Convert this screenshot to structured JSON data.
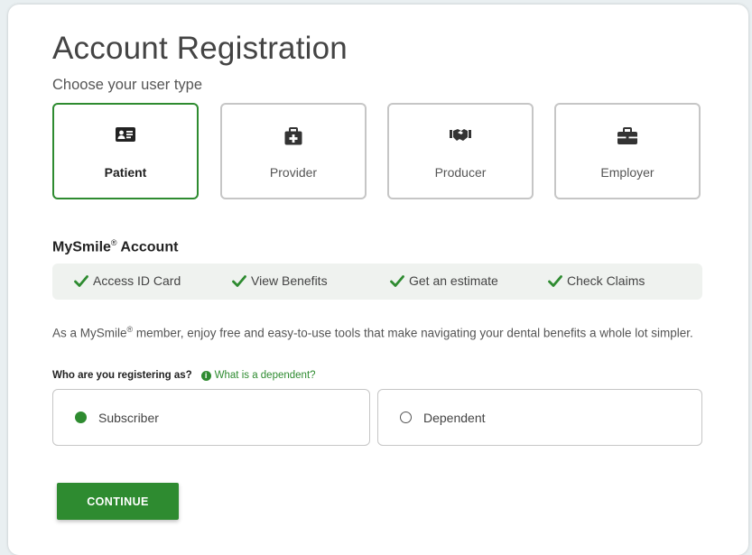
{
  "page": {
    "title": "Account Registration",
    "subtitle": "Choose your user type"
  },
  "user_types": [
    {
      "label": "Patient",
      "icon": "id-card-icon",
      "selected": true
    },
    {
      "label": "Provider",
      "icon": "medical-kit-icon",
      "selected": false
    },
    {
      "label": "Producer",
      "icon": "handshake-icon",
      "selected": false
    },
    {
      "label": "Employer",
      "icon": "briefcase-icon",
      "selected": false
    }
  ],
  "account": {
    "title": "MySmile",
    "title_mark": "®",
    "title_suffix": " Account",
    "features": [
      "Access ID Card",
      "View Benefits",
      "Get an estimate",
      "Check Claims"
    ],
    "desc_prefix": "As a MySmile",
    "desc_mark": "®",
    "desc_suffix": " member, enjoy free and easy-to-use tools that make navigating your dental benefits a whole lot simpler."
  },
  "registration": {
    "question": "Who are you registering as?",
    "dependent_link": "What is a dependent?",
    "options": [
      {
        "label": "Subscriber",
        "selected": true
      },
      {
        "label": "Dependent",
        "selected": false
      }
    ]
  },
  "actions": {
    "continue_label": "CONTINUE"
  },
  "colors": {
    "accent": "#2e8b30",
    "border": "#c6c6c6",
    "feature_bg": "#eff2ef"
  }
}
